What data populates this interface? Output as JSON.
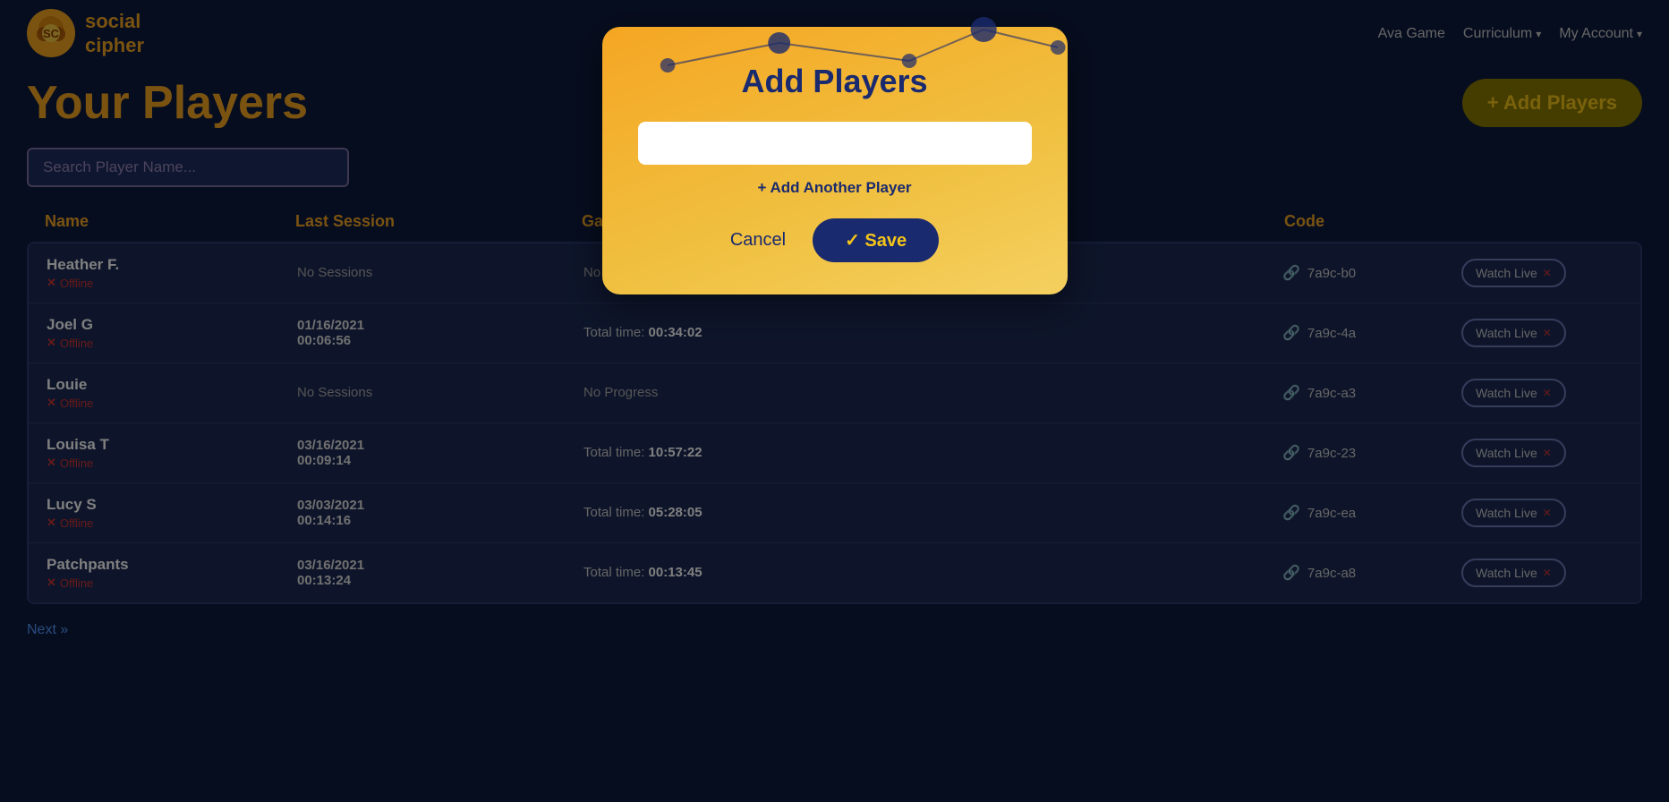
{
  "site": {
    "logo_line1": "social",
    "logo_line2": "cipher"
  },
  "nav": {
    "ava_game": "Ava Game",
    "curriculum": "Curriculum",
    "curriculum_arrow": "▾",
    "my_account": "My Account",
    "my_account_arrow": "▾"
  },
  "page": {
    "title": "Your Players",
    "add_players_label": "+ Add Players",
    "search_placeholder": "Search Player Name...",
    "next_label": "Next »"
  },
  "table": {
    "col_name": "Name",
    "col_last_session": "Last Session",
    "col_game_progress": "Game Progress",
    "col_code": "Code",
    "col_watch": ""
  },
  "players": [
    {
      "name": "Heather F.",
      "status": "Offline",
      "last_session": "No Sessions",
      "last_time": "",
      "progress": "No Progress",
      "progress_bold": "",
      "code": "7a9c-b0",
      "watch_label": "Watch Live"
    },
    {
      "name": "Joel G",
      "status": "Offline",
      "last_session": "01/16/2021",
      "last_time": "00:06:56",
      "progress": "Total time: ",
      "progress_bold": "00:34:02",
      "code": "7a9c-4a",
      "watch_label": "Watch Live"
    },
    {
      "name": "Louie",
      "status": "Offline",
      "last_session": "No Sessions",
      "last_time": "",
      "progress": "No Progress",
      "progress_bold": "",
      "code": "7a9c-a3",
      "watch_label": "Watch Live"
    },
    {
      "name": "Louisa T",
      "status": "Offline",
      "last_session": "03/16/2021",
      "last_time": "00:09:14",
      "progress": "Total time: ",
      "progress_bold": "10:57:22",
      "code": "7a9c-23",
      "watch_label": "Watch Live"
    },
    {
      "name": "Lucy S",
      "status": "Offline",
      "last_session": "03/03/2021",
      "last_time": "00:14:16",
      "progress": "Total time: ",
      "progress_bold": "05:28:05",
      "code": "7a9c-ea",
      "watch_label": "Watch Live"
    },
    {
      "name": "Patchpants",
      "status": "Offline",
      "last_session": "03/16/2021",
      "last_time": "00:13:24",
      "progress": "Total time: ",
      "progress_bold": "00:13:45",
      "code": "7a9c-a8",
      "watch_label": "Watch Live"
    }
  ],
  "modal": {
    "title": "Add Players",
    "input_placeholder": "",
    "add_another_label": "+ Add Another Player",
    "cancel_label": "Cancel",
    "save_label": "✓ Save"
  }
}
